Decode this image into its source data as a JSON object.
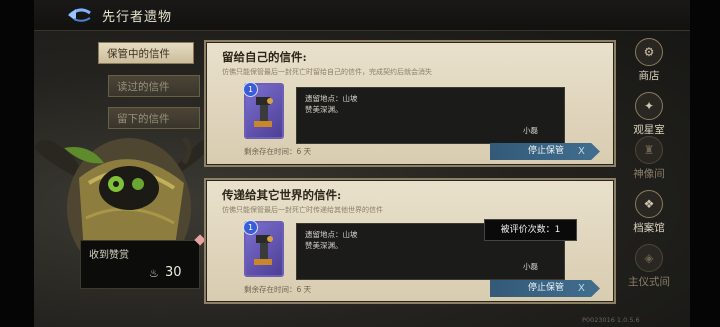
{
  "header": {
    "title": "先行者遗物"
  },
  "tabs": [
    {
      "label": "保管中的信件",
      "active": true
    },
    {
      "label": "读过的信件",
      "active": false
    },
    {
      "label": "留下的信件",
      "active": false
    }
  ],
  "praise": {
    "title": "收到赞赏",
    "count": "30"
  },
  "right_menu": [
    {
      "label": "商店",
      "icon": "shop-icon"
    },
    {
      "label": "观星室",
      "icon": "observatory-icon"
    },
    {
      "label": "神像间",
      "icon": "statue-icon"
    },
    {
      "label": "档案馆",
      "icon": "archive-icon"
    },
    {
      "label": "主仪式间",
      "icon": "ritual-icon"
    }
  ],
  "panels": [
    {
      "title": "留给自己的信件:",
      "desc": "仿佛只能保管最后一封死亡时留给自己的信件，完成契约后就会消失",
      "card_level": "1",
      "location": "遗留地点：山坡",
      "message": "赞美深渊。",
      "signature": "小磊",
      "time": "剩余存在时间：6 天",
      "stop_label": "停止保管",
      "stop_icon": "X"
    },
    {
      "title": "传递给其它世界的信件:",
      "desc": "仿佛只能保管最后一封死亡时传递给其他世界的信件",
      "card_level": "1",
      "location": "遗留地点：山坡",
      "message": "赞美深渊。",
      "signature": "小磊",
      "time": "剩余存在时间：6 天",
      "stop_label": "停止保管",
      "stop_icon": "X"
    }
  ],
  "tooltip": {
    "evaluation": "被评价次数：1"
  },
  "version": "P0023016  1.0.5.6",
  "colors": {
    "panel_bg": "#e3d9c1",
    "letter_bg": "#1b1b1a",
    "button_blue": "#3a6485",
    "card_purple": "#6a5cc0"
  }
}
